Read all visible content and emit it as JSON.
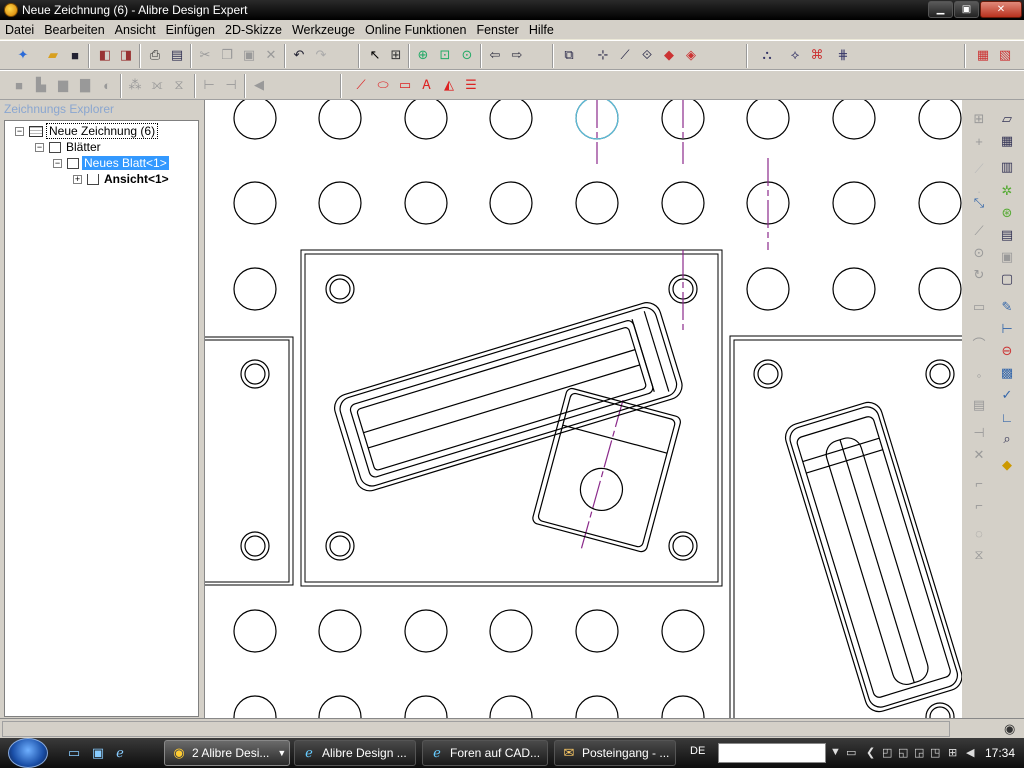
{
  "window": {
    "title": "Neue Zeichnung (6) - Alibre Design Expert",
    "minimize": "▁",
    "maximize": "▣",
    "close": "✕"
  },
  "menu": [
    "Datei",
    "Bearbeiten",
    "Ansicht",
    "Einfügen",
    "2D-Skizze",
    "Werkzeuge",
    "Online Funktionen",
    "Fenster",
    "Hilfe"
  ],
  "explorer": {
    "title": "Zeichnungs Explorer",
    "tree": [
      {
        "label": "Neue Zeichnung (6)",
        "expander": "−"
      },
      {
        "label": "Blätter",
        "expander": "−"
      },
      {
        "label": "Neues Blatt<1>",
        "expander": "−"
      },
      {
        "label": "Ansicht<1>",
        "expander": "+"
      }
    ]
  },
  "taskbar": {
    "buttons": [
      "2 Alibre Desi...",
      "Alibre Design ...",
      "Foren auf CAD...",
      "Posteingang - ..."
    ],
    "language": "DE",
    "clock": "17:34"
  },
  "colors": {
    "centerline": "#8b2a8b",
    "selected": "#3399ff",
    "highlight_circle": "#5bc0de"
  }
}
